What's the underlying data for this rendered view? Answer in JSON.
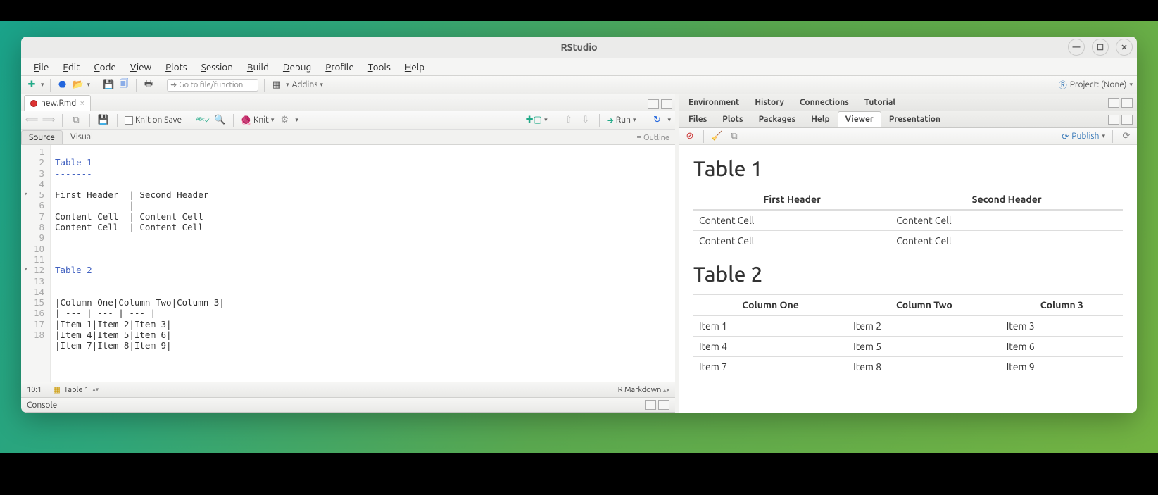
{
  "window": {
    "title": "RStudio"
  },
  "menubar": {
    "items": [
      "File",
      "Edit",
      "Code",
      "View",
      "Plots",
      "Session",
      "Build",
      "Debug",
      "Profile",
      "Tools",
      "Help"
    ]
  },
  "toolbar": {
    "goto_placeholder": "Go to file/function",
    "addins": "Addins",
    "project": "Project: (None)"
  },
  "file_tab": {
    "name": "new.Rmd"
  },
  "editor_toolbar": {
    "knit_on_save": "Knit on Save",
    "knit": "Knit",
    "run": "Run"
  },
  "source_tabs": {
    "source": "Source",
    "visual": "Visual",
    "outline": "Outline"
  },
  "code_lines": [
    "Table 1",
    "-------",
    "",
    "First Header  | Second Header",
    "------------- | -------------",
    "Content Cell  | Content Cell",
    "Content Cell  | Content Cell",
    "",
    "",
    "",
    "Table 2",
    "-------",
    "",
    "|Column One|Column Two|Column 3|",
    "| --- | --- | --- |",
    "|Item 1|Item 2|Item 3|",
    "|Item 4|Item 5|Item 6|",
    "|Item 7|Item 8|Item 9|"
  ],
  "status": {
    "pos": "10:1",
    "section": "Table 1",
    "mode": "R Markdown"
  },
  "console": {
    "label": "Console"
  },
  "top_right_tabs": [
    "Environment",
    "History",
    "Connections",
    "Tutorial"
  ],
  "bottom_right_tabs": [
    "Files",
    "Plots",
    "Packages",
    "Help",
    "Viewer",
    "Presentation"
  ],
  "viewer_tb": {
    "publish": "Publish"
  },
  "viewer": {
    "t1_title": "Table 1",
    "t1_headers": [
      "First Header",
      "Second Header"
    ],
    "t1_rows": [
      [
        "Content Cell",
        "Content Cell"
      ],
      [
        "Content Cell",
        "Content Cell"
      ]
    ],
    "t2_title": "Table 2",
    "t2_headers": [
      "Column One",
      "Column Two",
      "Column 3"
    ],
    "t2_rows": [
      [
        "Item 1",
        "Item 2",
        "Item 3"
      ],
      [
        "Item 4",
        "Item 5",
        "Item 6"
      ],
      [
        "Item 7",
        "Item 8",
        "Item 9"
      ]
    ]
  }
}
